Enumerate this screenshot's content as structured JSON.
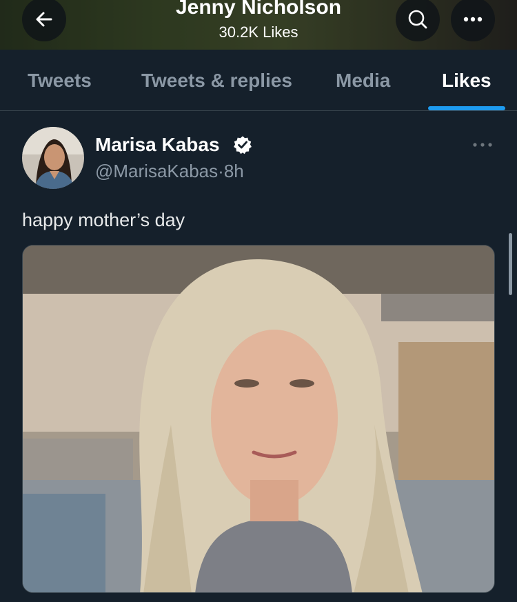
{
  "header": {
    "title": "Jenny Nicholson",
    "subtitle": "30.2K Likes",
    "back_icon": "arrow-left-icon",
    "search_icon": "search-icon",
    "more_icon": "more-horizontal-icon"
  },
  "tabs": [
    {
      "label": "Tweets",
      "active": false
    },
    {
      "label": "Tweets & replies",
      "active": false
    },
    {
      "label": "Media",
      "active": false
    },
    {
      "label": "Likes",
      "active": true
    }
  ],
  "tweet": {
    "author_name": "Marisa Kabas",
    "verified": true,
    "handle": "@MarisaKabas",
    "separator": "·",
    "time": "8h",
    "text": "happy mother’s day",
    "media_type": "video-still"
  },
  "colors": {
    "background": "#15202b",
    "accent": "#1d9bf0",
    "muted_text": "#8b98a5",
    "divider": "#38444d"
  }
}
